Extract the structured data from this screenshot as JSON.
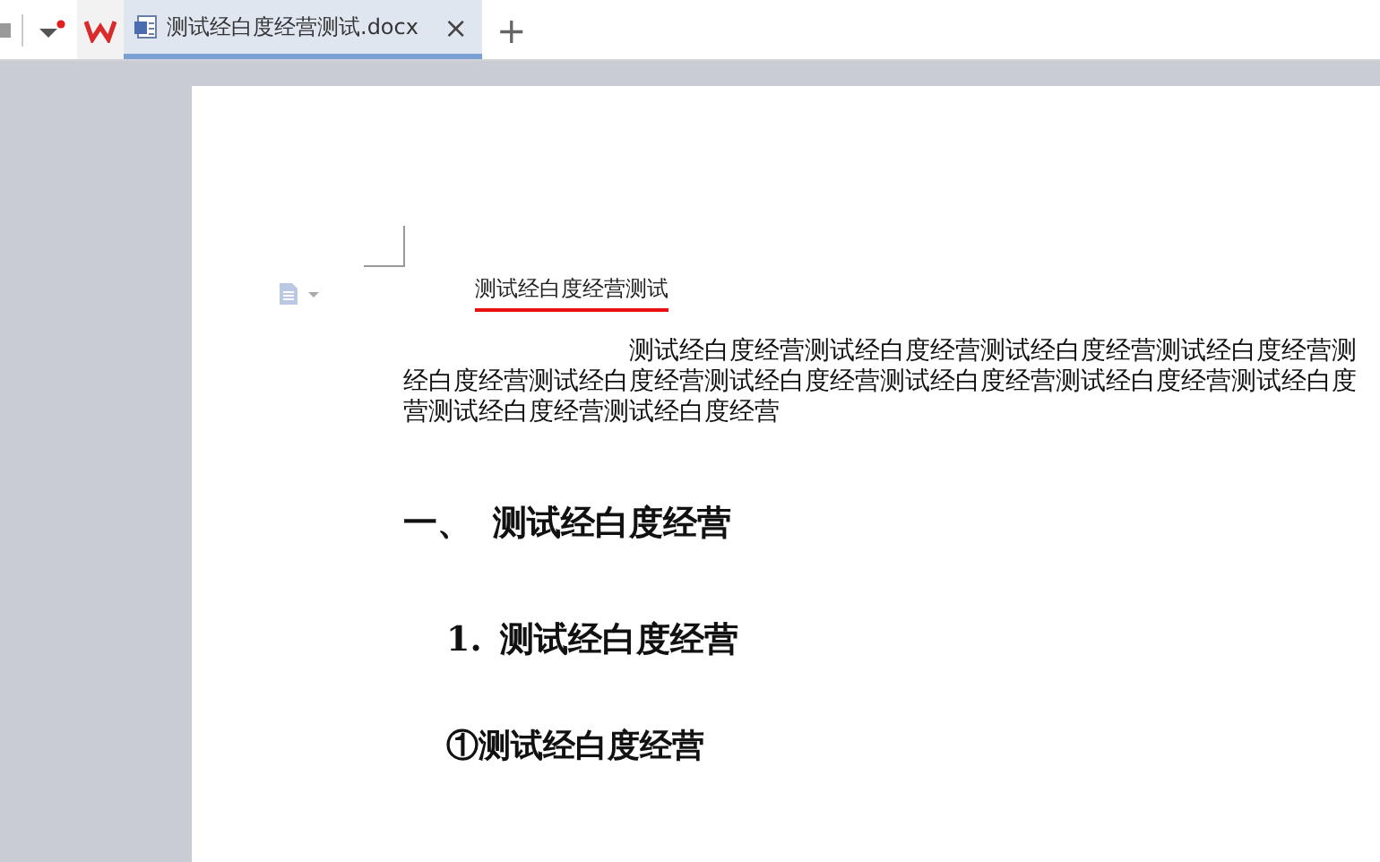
{
  "tabs": [
    {
      "label": "测试经白度经营测试.docx",
      "close": "×",
      "selected": true
    }
  ],
  "new_tab": "+",
  "document": {
    "title": {
      "text": "测试经白度经营测试",
      "flagged": true
    },
    "paragraph_lines": [
      "测试经白度经营测试经白度经营测试经白度经营测试经白度经营测",
      "经白度经营测试经白度经营测试经白度经营测试经白度经营测试经白度经营测试经白度",
      "营测试经白度经营测试经白度经营"
    ],
    "headings": [
      {
        "kind": "h1",
        "number": "一、",
        "text": "测试经白度经营"
      },
      {
        "kind": "h2",
        "number": "1.",
        "text": "测试经白度经营"
      },
      {
        "kind": "h3",
        "number": "①",
        "text": "测试经白度经营"
      }
    ]
  }
}
